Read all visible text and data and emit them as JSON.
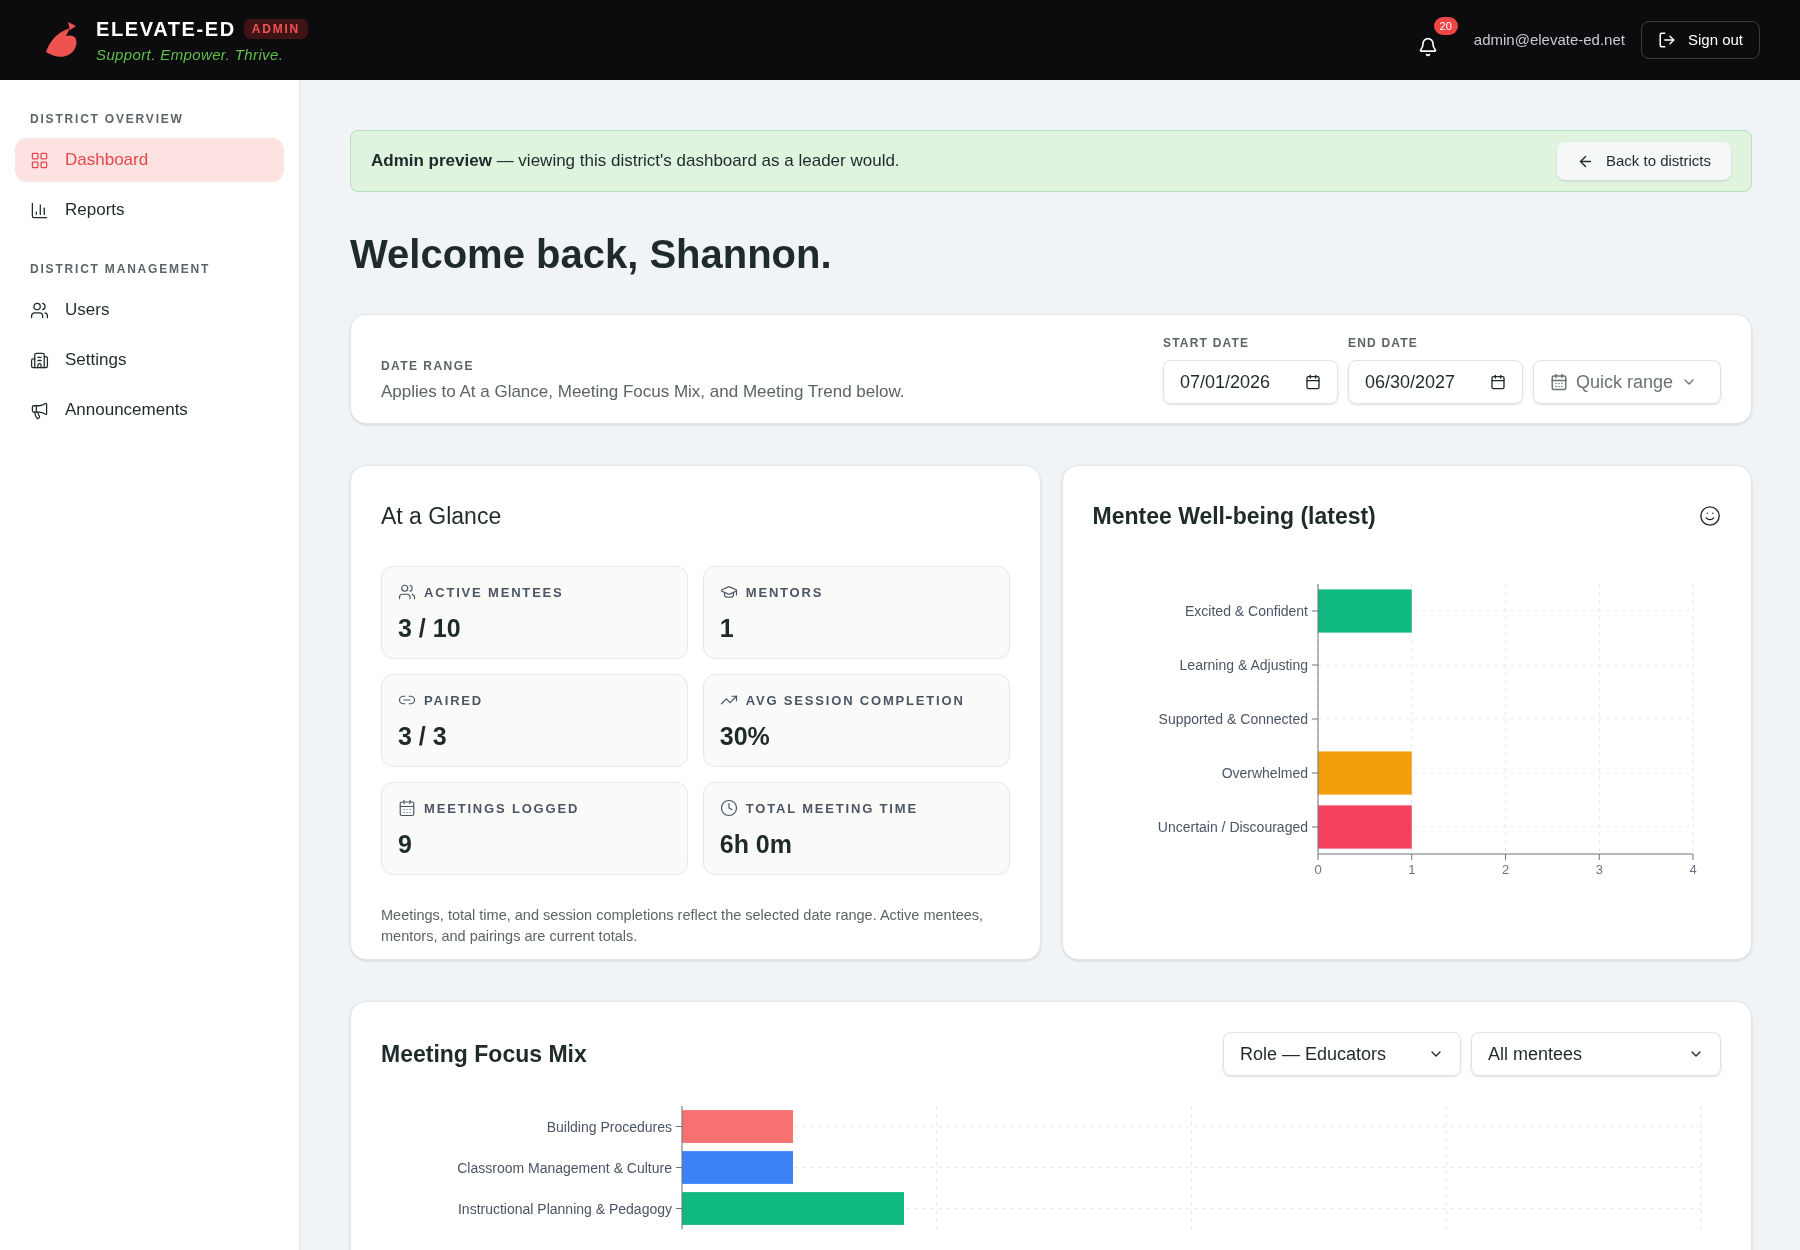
{
  "header": {
    "brand": "ELEVATE-ED",
    "badge": "ADMIN",
    "tagline": "Support. Empower. Thrive.",
    "notification_count": "20",
    "email": "admin@elevate-ed.net",
    "sign_out": "Sign out"
  },
  "sidebar": {
    "sections": [
      {
        "title": "DISTRICT OVERVIEW",
        "items": [
          {
            "label": "Dashboard",
            "selected": true
          },
          {
            "label": "Reports",
            "selected": false
          }
        ]
      },
      {
        "title": "DISTRICT MANAGEMENT",
        "items": [
          {
            "label": "Users",
            "selected": false
          },
          {
            "label": "Settings",
            "selected": false
          },
          {
            "label": "Announcements",
            "selected": false
          }
        ]
      }
    ]
  },
  "banner": {
    "text": "**Admin preview** — viewing this district's dashboard as a leader would.",
    "button": "Back to districts"
  },
  "greeting": "Welcome back, Shannon.",
  "date_range": {
    "label": "DATE RANGE",
    "description": "Applies to At a Glance, Meeting Focus Mix, and Meeting Trend below.",
    "start_label": "START DATE",
    "start_value": "07/01/2026",
    "end_label": "END DATE",
    "end_value": "06/30/2027",
    "quick_range": "Quick range"
  },
  "at_a_glance": {
    "title": "At a Glance",
    "stats": [
      {
        "label": "ACTIVE MENTEES",
        "value": "3 / 10"
      },
      {
        "label": "MENTORS",
        "value": "1"
      },
      {
        "label": "PAIRED",
        "value": "3 / 3"
      },
      {
        "label": "AVG SESSION COMPLETION",
        "value": "30%"
      },
      {
        "label": "MEETINGS LOGGED",
        "value": "9"
      },
      {
        "label": "TOTAL MEETING TIME",
        "value": "6h 0m"
      }
    ],
    "note": "Meetings, total time, and session completions reflect the selected date range. Active mentees, mentors, and pairings are current totals."
  },
  "wellbeing": {
    "title": "Mentee Well-being (latest)",
    "chart_data": {
      "type": "bar",
      "orientation": "horizontal",
      "grid": true,
      "stacked": true,
      "categories": [
        "Excited & Confident",
        "Learning & Adjusting",
        "Supported & Connected",
        "Overwhelmed",
        "Uncertain / Discouraged"
      ],
      "series": [
        {
          "color": "#10b981",
          "values": [
            1,
            null,
            null,
            null,
            null
          ]
        },
        {
          "color": "#f59e0b",
          "values": [
            null,
            null,
            null,
            1,
            null
          ]
        },
        {
          "color": "#f43f5e",
          "values": [
            null,
            null,
            null,
            null,
            1
          ]
        }
      ],
      "xlim": [
        0,
        4
      ],
      "xticks": [
        0,
        1,
        2,
        3,
        4
      ]
    }
  },
  "focus_mix": {
    "title": "Meeting Focus Mix",
    "filters": [
      "Role — Educators",
      "All mentees"
    ],
    "bars": [
      {
        "label": "Building Procedures",
        "color": "#f87171"
      },
      {
        "label": "Classroom Management & Culture",
        "color": "#3b82f6"
      },
      {
        "label": "Instructional Planning & Pedagogy",
        "color": "#10b981"
      }
    ]
  }
}
